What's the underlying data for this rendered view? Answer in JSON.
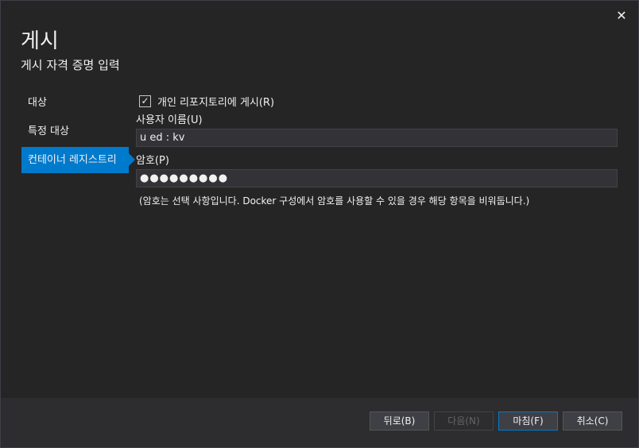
{
  "dialog": {
    "close_glyph": "✕",
    "title": "게시",
    "subtitle": "게시 자격 증명 입력"
  },
  "nav": {
    "items": [
      {
        "label": "대상"
      },
      {
        "label": "특정 대상"
      },
      {
        "label": "컨테이너 레지스트리"
      }
    ]
  },
  "form": {
    "checkbox_label": "개인 리포지토리에 게시(R)",
    "checkbox_checked": true,
    "username_label": "사용자 이름(U)",
    "username_value": "u ed : kv",
    "password_label": "암호(P)",
    "password_value": "●●●●●●●●●",
    "note": "(암호는 선택 사항입니다. Docker 구성에서 암호를 사용할 수 있을 경우 해당 항목을 비워둡니다.)"
  },
  "footer": {
    "back_label": "뒤로(B)",
    "next_label": "다음(N)",
    "finish_label": "마침(F)",
    "cancel_label": "취소(C)"
  },
  "colors": {
    "accent": "#007acc",
    "background": "#252526"
  }
}
